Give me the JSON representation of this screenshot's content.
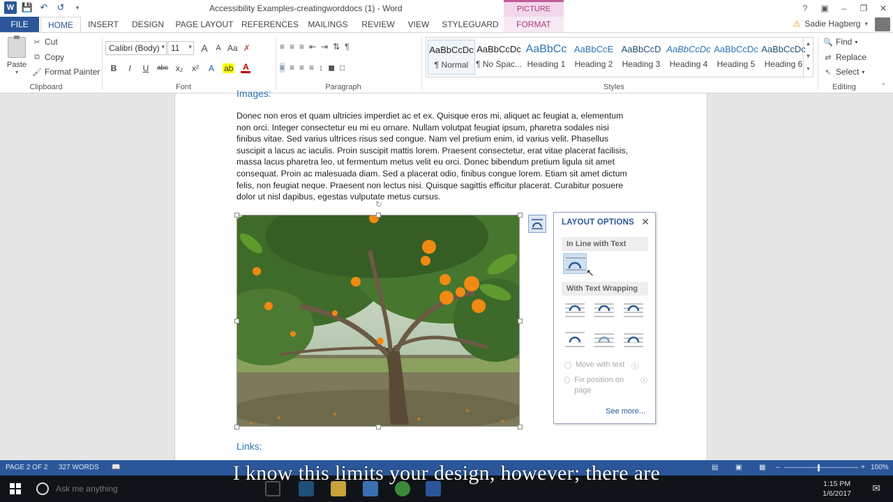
{
  "window": {
    "title": "Accessibility Examples-creatingworddocs (1) - Word",
    "context_tab_header": "PICTURE TOOLS",
    "controls": [
      "?",
      "❐",
      "–",
      "❐",
      "✕"
    ]
  },
  "tabs": [
    "FILE",
    "HOME",
    "INSERT",
    "DESIGN",
    "PAGE LAYOUT",
    "REFERENCES",
    "MAILINGS",
    "REVIEW",
    "VIEW",
    "STYLEGUARD",
    "FORMAT"
  ],
  "user": {
    "name": "Sadie Hagberg"
  },
  "clipboard": {
    "paste": "Paste",
    "cut": "Cut",
    "copy": "Copy",
    "format_painter": "Format Painter",
    "label": "Clipboard"
  },
  "font": {
    "name": "Calibri (Body)",
    "size": "11",
    "label": "Font",
    "grow": "A",
    "shrink": "A",
    "case": "Aa",
    "bold": "B",
    "italic": "I",
    "underline": "U",
    "strike": "abc",
    "sub": "x₂",
    "sup": "x²"
  },
  "paragraph": {
    "label": "Paragraph",
    "pilcrow": "¶"
  },
  "styles": {
    "label": "Styles",
    "items": [
      {
        "preview": "AaBbCcDc",
        "name": "¶ Normal"
      },
      {
        "preview": "AaBbCcDc",
        "name": "¶ No Spac..."
      },
      {
        "preview": "AaBbCc",
        "name": "Heading 1"
      },
      {
        "preview": "AaBbCcE",
        "name": "Heading 2"
      },
      {
        "preview": "AaBbCcD",
        "name": "Heading 3"
      },
      {
        "preview": "AaBbCcDc",
        "name": "Heading 4"
      },
      {
        "preview": "AaBbCcDc",
        "name": "Heading 5"
      },
      {
        "preview": "AaBbCcDc",
        "name": "Heading 6"
      }
    ]
  },
  "editing": {
    "label": "Editing",
    "find": "Find",
    "replace": "Replace",
    "select": "Select"
  },
  "document": {
    "heading_cut": "Images:",
    "body_lines": [
      "Donec non eros et quam ultricies imperdiet ac et ex. Quisque eros mi, aliquet ac feugiat a, elementum",
      "non orci. Integer consectetur eu mi eu ornare. Nullam volutpat feugiat ipsum, pharetra sodales nisi",
      "finibus vitae. Sed varius ultrices risus sed congue. Nam vel pretium enim, id varius velit. Phasellus",
      "suscipit a lacus ac iaculis. Proin suscipit mattis lorem. Praesent consectetur, erat vitae placerat facilisis,",
      "massa lacus pharetra leo, ut fermentum metus velit eu orci. Donec bibendum pretium ligula sit amet",
      "consequat. Proin ac malesuada diam. Sed a placerat odio, finibus congue lorem. Etiam sit amet dictum",
      "felis, non feugiat neque. Praesent non lectus nisi. Quisque sagittis efficitur placerat. Curabitur posuere",
      "dolor ut nisl dapibus, egestas vulputate metus cursus."
    ],
    "links_heading": "Links:"
  },
  "layout_options": {
    "title": "LAYOUT OPTIONS",
    "close": "✕",
    "inline_section": "In Line with Text",
    "wrapping_section": "With Text Wrapping",
    "move_with_text": "Move with text",
    "fix_position": "Fix position on page",
    "see_more": "See more..."
  },
  "statusbar": {
    "page": "PAGE 2 OF 2",
    "words": "327 WORDS",
    "zoom": "100%"
  },
  "taskbar": {
    "search": "Ask me anything",
    "time": "1:15 PM",
    "date": "1/6/2017"
  },
  "caption": "I know this limits your design, however; there are",
  "colors": {
    "accent": "#2b579a",
    "format_tab": "#b0357f",
    "heading": "#2e74b5"
  }
}
